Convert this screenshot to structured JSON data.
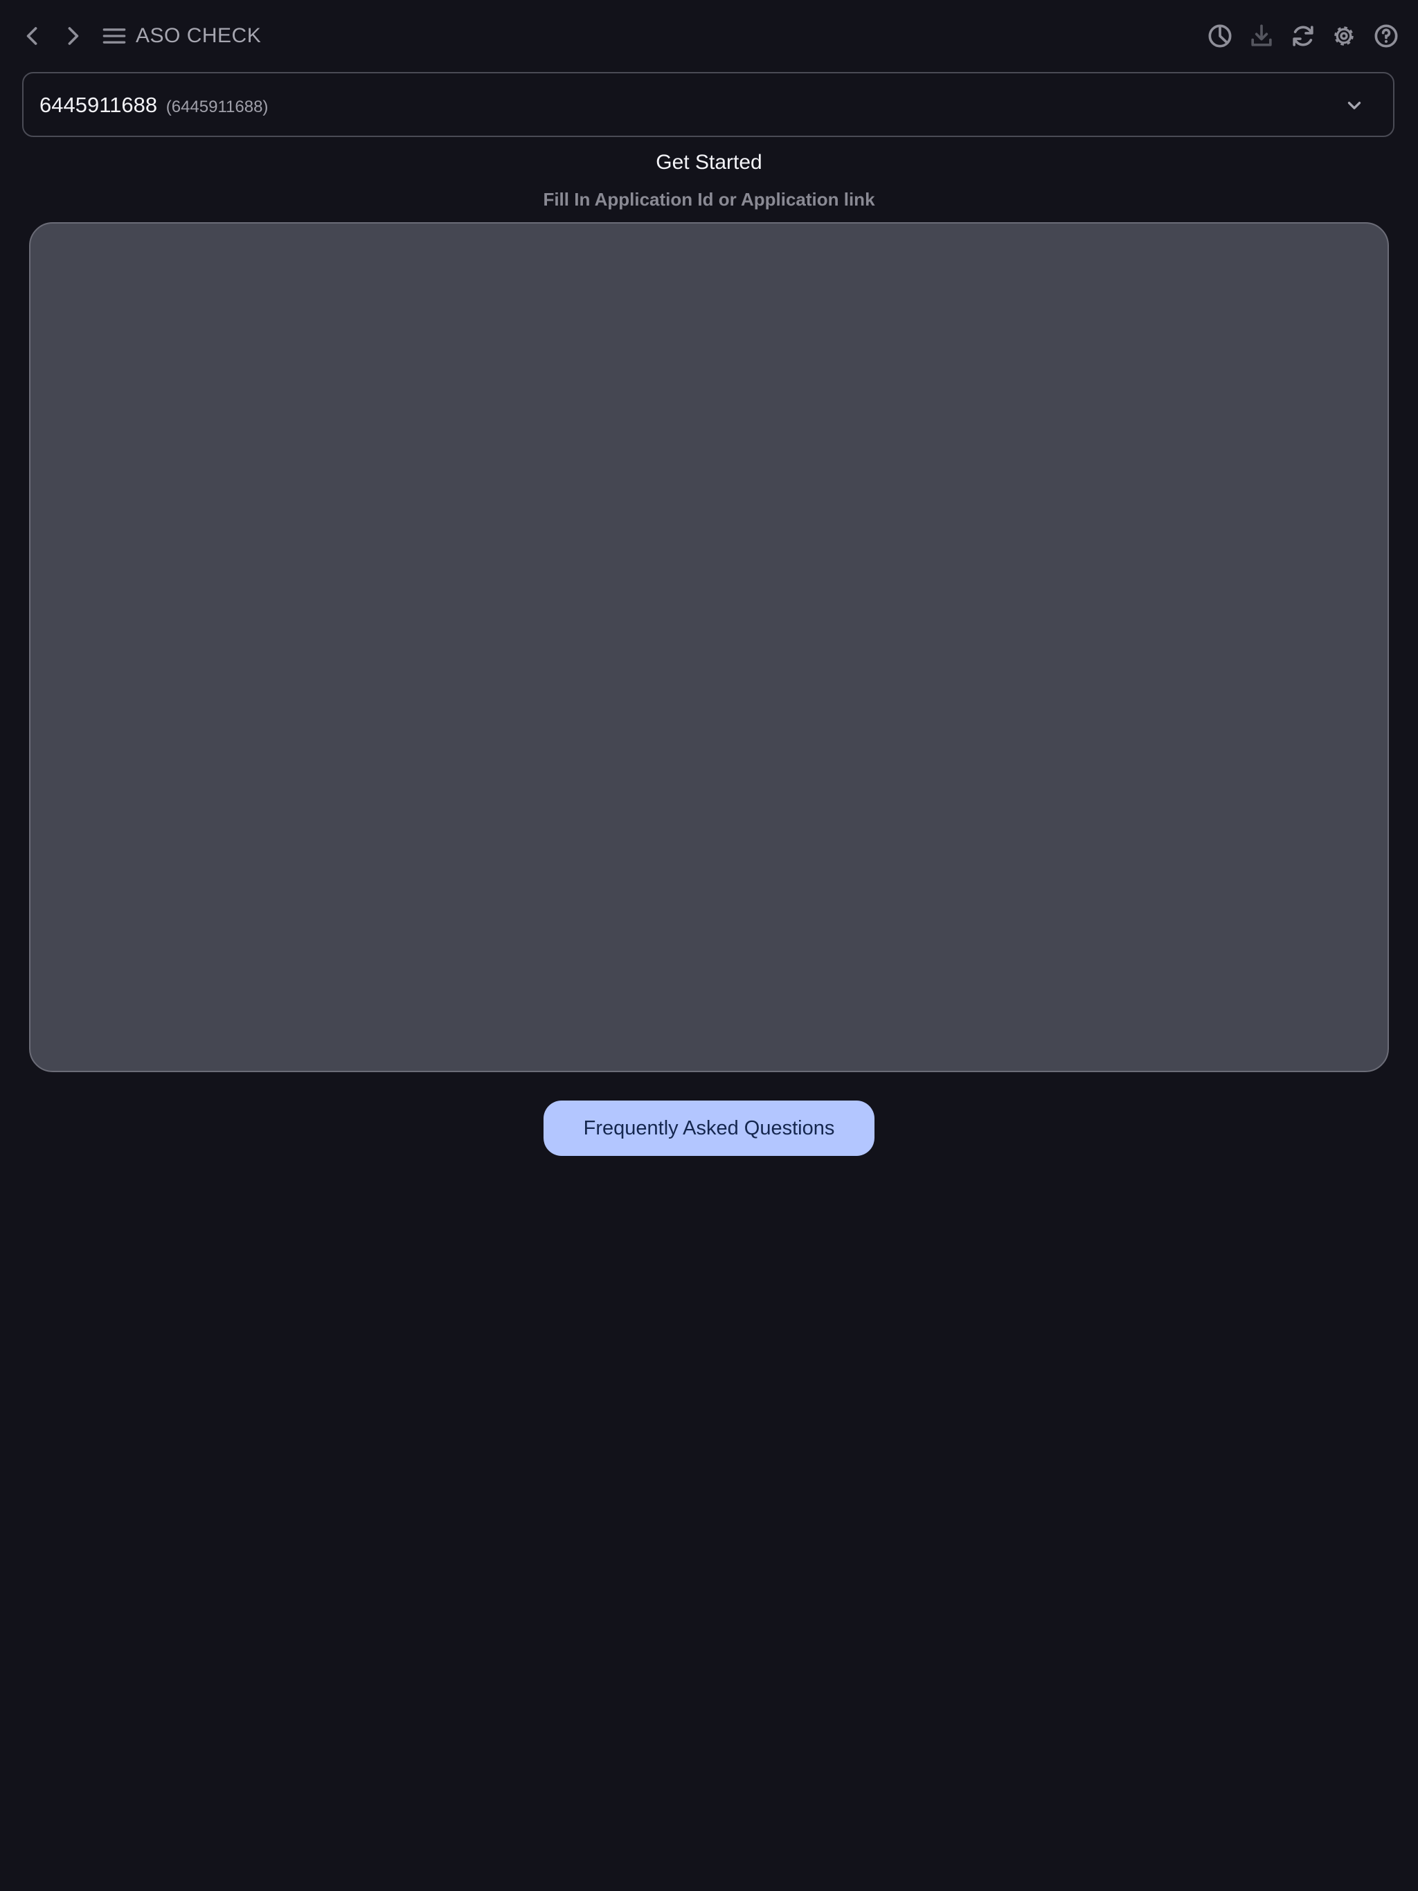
{
  "toolbar": {
    "back_icon": "chevron-left-icon",
    "forward_icon": "chevron-right-icon",
    "menu_icon": "hamburger-menu-icon",
    "title": "ASO CHECK",
    "right_icons": [
      "pie-chart-icon",
      "download-icon",
      "refresh-icon",
      "gear-icon",
      "help-icon"
    ]
  },
  "app_select": {
    "selected_value": "6445911688",
    "selected_detail": "(6445911688)",
    "chevron_icon": "chevron-down-icon"
  },
  "main": {
    "heading": "Get Started",
    "instruction": "Fill In Application Id or Application link",
    "input_value": ""
  },
  "faq": {
    "label": "Frequently Asked Questions"
  },
  "colors": {
    "background": "#12121a",
    "input_background": "#454752",
    "faq_button_background": "#b3c6ff",
    "faq_button_text": "#15274f"
  }
}
